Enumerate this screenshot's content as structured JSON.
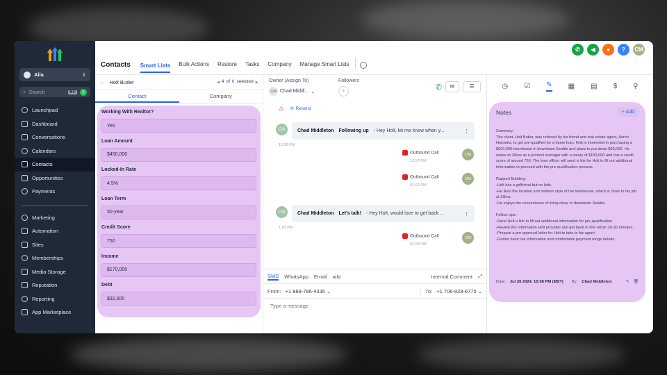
{
  "brand": {
    "accent": "#2563eb",
    "sidebar_bg": "#1f2937",
    "highlight": "#e6c6f5"
  },
  "sidebar": {
    "account": "Aila",
    "search_placeholder": "Search",
    "search_kbd": "⌘K",
    "items": [
      {
        "label": "Launchpad",
        "icon": "rocket-icon"
      },
      {
        "label": "Dashboard",
        "icon": "dashboard-icon"
      },
      {
        "label": "Conversations",
        "icon": "chat-icon"
      },
      {
        "label": "Calendars",
        "icon": "calendar-icon"
      },
      {
        "label": "Contacts",
        "icon": "contacts-icon",
        "active": true
      },
      {
        "label": "Opportunities",
        "icon": "funnel-icon"
      },
      {
        "label": "Payments",
        "icon": "payments-icon"
      }
    ],
    "items2": [
      {
        "label": "Marketing",
        "icon": "send-icon"
      },
      {
        "label": "Automation",
        "icon": "automation-icon"
      },
      {
        "label": "Sites",
        "icon": "sites-icon"
      },
      {
        "label": "Memberships",
        "icon": "memberships-icon"
      },
      {
        "label": "Media Storage",
        "icon": "media-icon"
      },
      {
        "label": "Reputation",
        "icon": "star-icon"
      },
      {
        "label": "Reporting",
        "icon": "chart-icon"
      },
      {
        "label": "App Marketplace",
        "icon": "grid-icon"
      }
    ]
  },
  "header": {
    "title": "Contacts",
    "tabs": [
      "Smart Lists",
      "Bulk Actions",
      "Restore",
      "Tasks",
      "Company",
      "Manage Smart Lists"
    ],
    "avatar": "CM",
    "help": "?"
  },
  "contact": {
    "name": "Holt Butler",
    "pager_current": "4",
    "pager_of": "of",
    "pager_total": "6",
    "pager_selected": "selected",
    "tabs": [
      "Contact",
      "Company"
    ],
    "fields": [
      {
        "label": "Working With Realtor?",
        "value": "Yes"
      },
      {
        "label": "Loan Amount",
        "value": "$450,000"
      },
      {
        "label": "Locked-In Rate",
        "value": "4.5%"
      },
      {
        "label": "Loan Term",
        "value": "30-year"
      },
      {
        "label": "Credit Score",
        "value": "750"
      },
      {
        "label": "Income",
        "value": "$170,000"
      },
      {
        "label": "Debt",
        "value": "$32,600"
      }
    ]
  },
  "conversation": {
    "owner_label": "Owner (Assign To)",
    "owner_initials": "CM",
    "owner_name": "Chad Middl...",
    "followers_label": "Followers",
    "resend": "Resend",
    "messages": [
      {
        "initials": "CM",
        "sender": "Chad Middleton",
        "subject": "Following up",
        "preview": "-  Hey Holt, let me know when y...",
        "time": "12:58 PM"
      },
      {
        "initials": "CM",
        "sender": "Chad Middleton",
        "subject": "Let's talk!",
        "preview": "-  Hey Holt, would love to get back ...",
        "time": "1:03 PM"
      }
    ],
    "calls": [
      {
        "label": "Outbound Call",
        "time": "12:57 PM",
        "initials": "CM"
      },
      {
        "label": "Outbound Call",
        "time": "01:02 PM",
        "initials": "CM"
      },
      {
        "label": "Outbound Call",
        "time": "01:08 PM",
        "initials": "CM"
      }
    ],
    "composer": {
      "tabs": [
        "SMS",
        "WhatsApp",
        "Email",
        "aila"
      ],
      "internal": "Internal Comment",
      "from_label": "From:",
      "from_number": "+1 888-786-4335",
      "to_label": "To:",
      "to_number": "+1 706-928-6775",
      "placeholder": "Type a message"
    }
  },
  "notes": {
    "title": "Notes",
    "add": "+ Add",
    "body": "Summary:\nThe client, Holt Butler, was referred by his friend and real estate agent, Aaron Horowitz, to get pre-qualified for a home loan. Holt is interested in purchasing a $500,000 townhouse in downtown Seattle and plans to put down $50,000. He works at Zillow as a product manager with a salary of $150,000 and has a credit score of around 750. The loan officer will send a link for Holt to fill out additional information to proceed with the pre-qualification process.\n\nRapport Building:\n-Holt has a girlfriend but no kids.\n-He likes the location and modern style of the townhouse, which is close to his job at Zillow.\n-He enjoys the convenience of living close to downtown Seattle.\n\nFollow Ups:\n-Send Holt a link to fill out additional information for pre-qualification.\n-Review the information Holt provides and get back to him within 20-30 minutes.\n-Prepare a pre-approval letter for Holt to take to his agent.\n-Gather basic tax information and comfortable payment range details.",
    "date_label": "Date:",
    "date": "Jul 26 2024, 10:58 PM (MST)",
    "by_label": "By:",
    "author": "Chad Middleton"
  }
}
